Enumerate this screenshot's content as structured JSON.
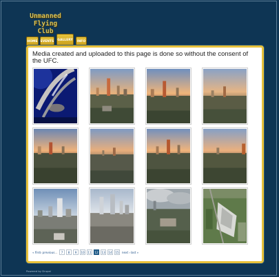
{
  "site": {
    "logo_lines": [
      "Unmanned",
      "Flying",
      "Club"
    ]
  },
  "nav": {
    "tabs": [
      {
        "label": "HOME",
        "active": false
      },
      {
        "label": "EVENTS",
        "active": false
      },
      {
        "label": "GALLERY",
        "active": true
      },
      {
        "label": "INFO",
        "active": false
      }
    ]
  },
  "main": {
    "message": "Media created and uploaded to this page is done so without the consent of the UFC."
  },
  "gallery": {
    "thumbnails": [
      {
        "subject": "blurred-rotor"
      },
      {
        "subject": "city-sunset"
      },
      {
        "subject": "city-sunset"
      },
      {
        "subject": "city-sunset"
      },
      {
        "subject": "city-sunset"
      },
      {
        "subject": "city-sunset"
      },
      {
        "subject": "city-sunset"
      },
      {
        "subject": "city-sunset"
      },
      {
        "subject": "city-day"
      },
      {
        "subject": "city-day"
      },
      {
        "subject": "city-clouds"
      },
      {
        "subject": "campus-aerial"
      }
    ]
  },
  "pager": {
    "first": "« first",
    "previous": "‹ previous",
    "ellipsis": "…",
    "pages": [
      "7",
      "8",
      "9",
      "10",
      "11",
      "12",
      "13",
      "14",
      "15"
    ],
    "current": "12",
    "next": "next ›",
    "last": "last »"
  },
  "footer": {
    "text": "Powered by Drupal"
  },
  "colors": {
    "background": "#0e3554",
    "accent": "#e8c13a",
    "link": "#1e4f86",
    "current_page": "#1f5a87"
  }
}
